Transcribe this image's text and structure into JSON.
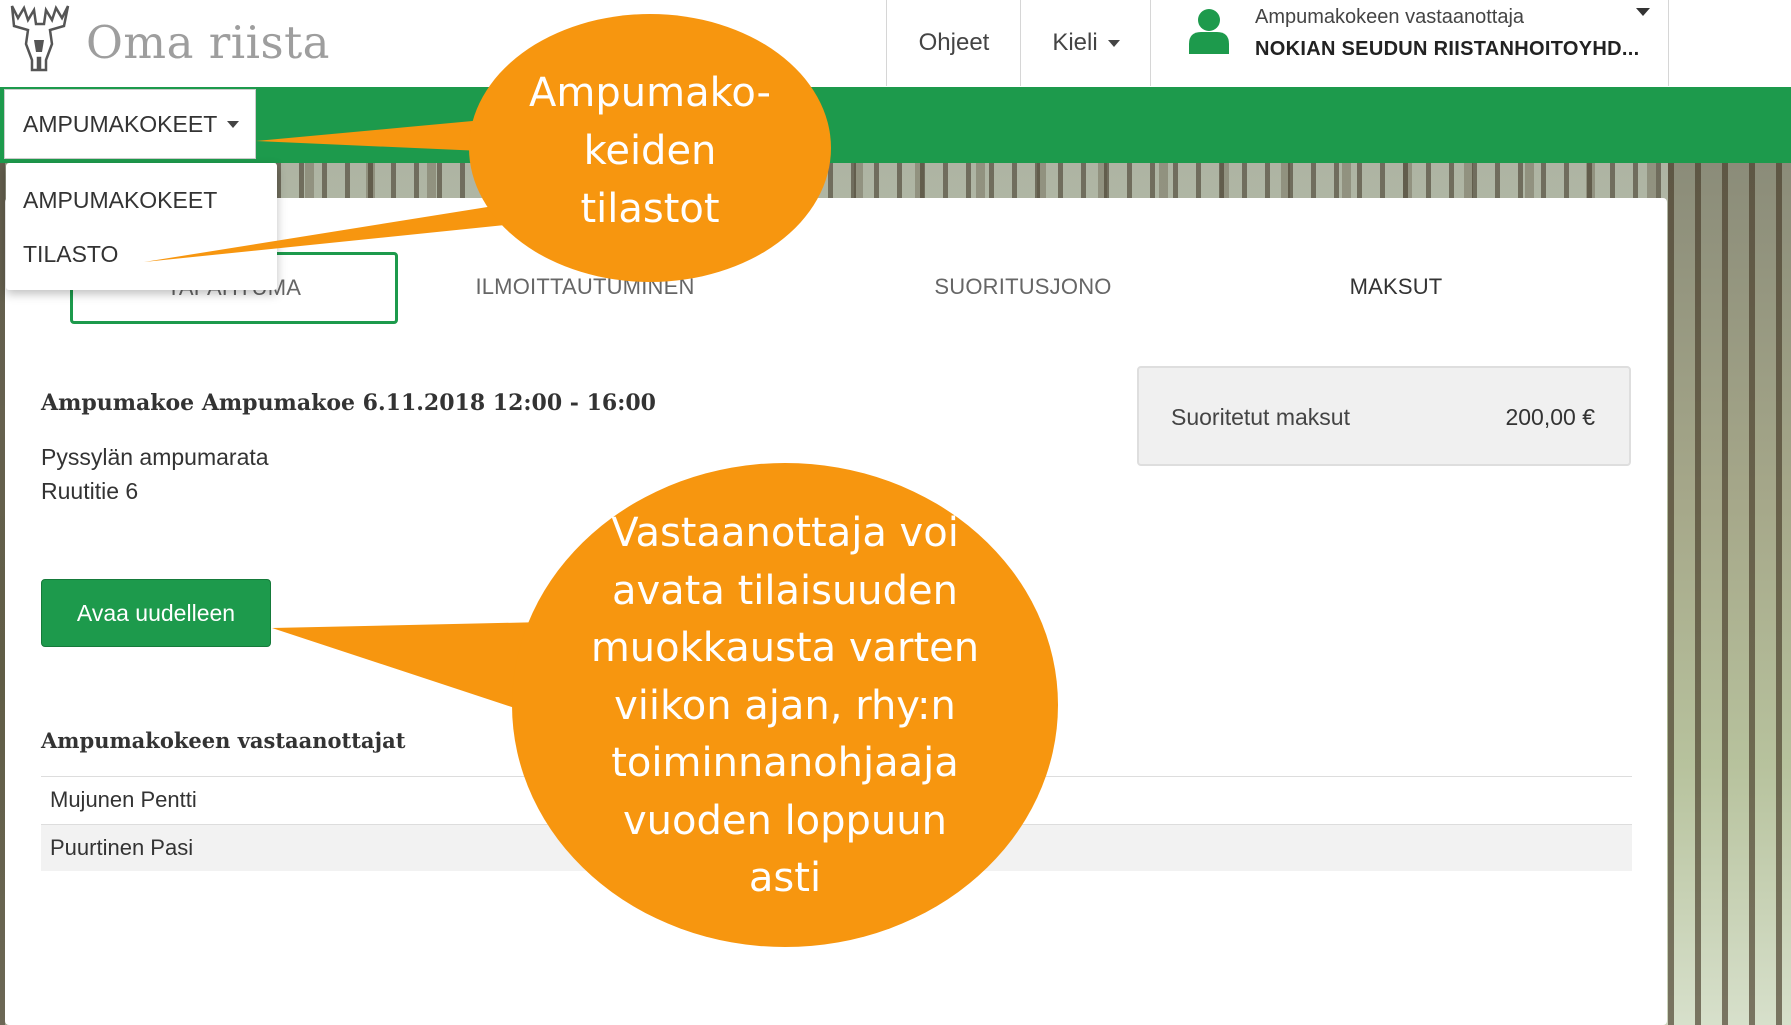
{
  "header": {
    "brand": "Oma riista",
    "nav": {
      "help": "Ohjeet",
      "language": "Kieli"
    },
    "user": {
      "role": "Ampumakokeen vastaanottaja",
      "org": "NOKIAN SEUDUN RIISTANHOITOYHD..."
    }
  },
  "menu": {
    "toggle": "AMPUMAKOKEET",
    "items": [
      "AMPUMAKOKEET",
      "TILASTO"
    ]
  },
  "tabs": [
    "TAPAHTUMA",
    "ILMOITTAUTUMINEN",
    "SUORITUSJONO",
    "MAKSUT"
  ],
  "event": {
    "title": "Ampumakoe Ampumakoe 6.11.2018 12:00 - 16:00",
    "location": "Pyssylän ampumarata",
    "address": "Ruutitie 6",
    "reopen_label": "Avaa uudelleen"
  },
  "payments": {
    "label": "Suoritetut maksut",
    "value": "200,00 €"
  },
  "receivers": {
    "heading": "Ampumakokeen vastaanottajat",
    "names": [
      "Mujunen Pentti",
      "Puurtinen Pasi"
    ]
  },
  "callouts": {
    "stats_lines": [
      "Ampumako-",
      "keiden",
      "tilastot"
    ],
    "reopen_lines": [
      "Vastaanottaja voi",
      "avata tilaisuuden",
      "muokkausta varten",
      "viikon ajan, rhy:n",
      "toiminnanohjaaja",
      "vuoden loppuun",
      "asti"
    ]
  },
  "colors": {
    "brand_green": "#1d9a4c",
    "callout_orange": "#f7960f"
  }
}
